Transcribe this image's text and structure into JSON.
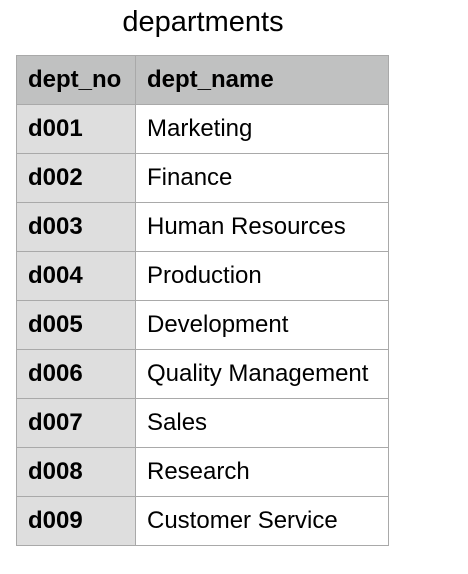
{
  "title": "departments",
  "columns": [
    "dept_no",
    "dept_name"
  ],
  "rows": [
    [
      "d001",
      "Marketing"
    ],
    [
      "d002",
      "Finance"
    ],
    [
      "d003",
      "Human Resources"
    ],
    [
      "d004",
      "Production"
    ],
    [
      "d005",
      "Development"
    ],
    [
      "d006",
      "Quality Management"
    ],
    [
      "d007",
      "Sales"
    ],
    [
      "d008",
      "Research"
    ],
    [
      "d009",
      "Customer Service"
    ]
  ],
  "colors": {
    "header_bg": "#c0c1c1",
    "key_column_bg": "#dedede",
    "cell_bg": "#ffffff",
    "border": "#a9a9a9"
  }
}
